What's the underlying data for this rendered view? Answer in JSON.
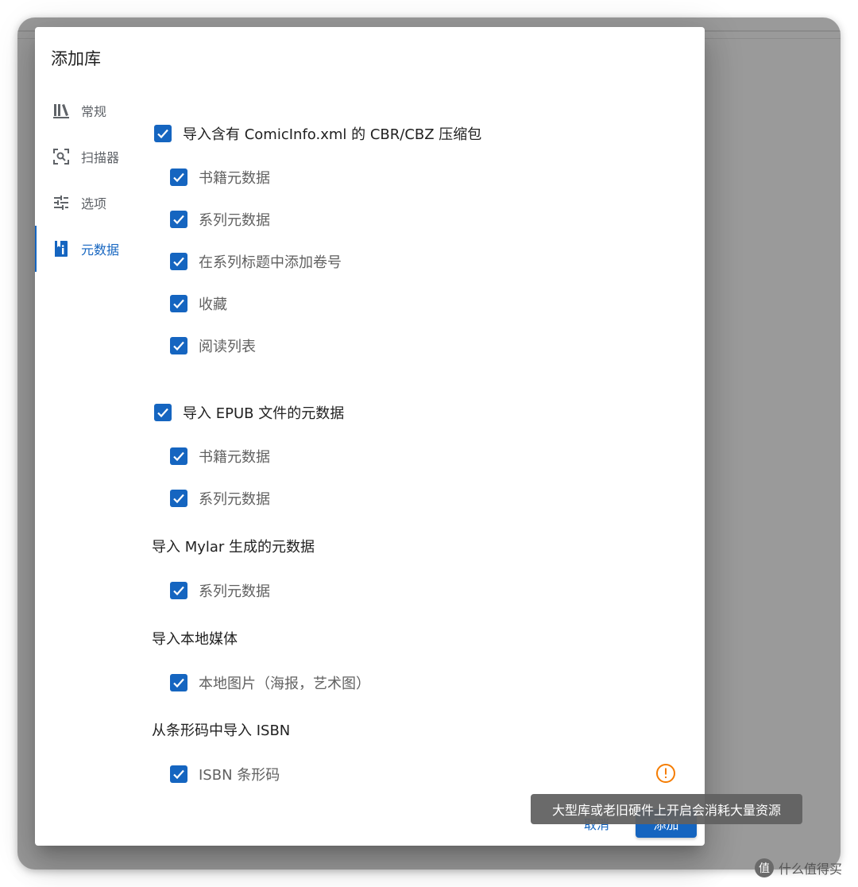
{
  "dialog": {
    "title": "添加库"
  },
  "nav": [
    {
      "label": "常规",
      "icon": "library-books-icon"
    },
    {
      "label": "扫描器",
      "icon": "scan-icon"
    },
    {
      "label": "选项",
      "icon": "tune-icon"
    },
    {
      "label": "元数据",
      "icon": "metadata-icon",
      "active": true
    }
  ],
  "comicinfo": {
    "label": "导入含有 ComicInfo.xml 的 CBR/CBZ 压缩包",
    "checked": true,
    "children": [
      {
        "label": "书籍元数据",
        "checked": true
      },
      {
        "label": "系列元数据",
        "checked": true
      },
      {
        "label": "在系列标题中添加卷号",
        "checked": true
      },
      {
        "label": "收藏",
        "checked": true
      },
      {
        "label": "阅读列表",
        "checked": true
      }
    ]
  },
  "epub": {
    "label": "导入 EPUB 文件的元数据",
    "checked": true,
    "children": [
      {
        "label": "书籍元数据",
        "checked": true
      },
      {
        "label": "系列元数据",
        "checked": true
      }
    ]
  },
  "mylar": {
    "heading": "导入 Mylar 生成的元数据",
    "children": [
      {
        "label": "系列元数据",
        "checked": true
      }
    ]
  },
  "local_media": {
    "heading": "导入本地媒体",
    "children": [
      {
        "label": "本地图片（海报，艺术图）",
        "checked": true
      }
    ]
  },
  "isbn": {
    "heading": "从条形码中导入 ISBN",
    "children": [
      {
        "label": "ISBN 条形码",
        "checked": true
      }
    ]
  },
  "actions": {
    "cancel": "取消",
    "add": "添加"
  },
  "tooltip": "大型库或老旧硬件上开启会消耗大量资源",
  "watermark": {
    "badge": "值",
    "text": "什么值得买"
  },
  "colors": {
    "primary": "#1565c0",
    "warning": "#f57c00",
    "overlay": "#9a9a9a"
  }
}
